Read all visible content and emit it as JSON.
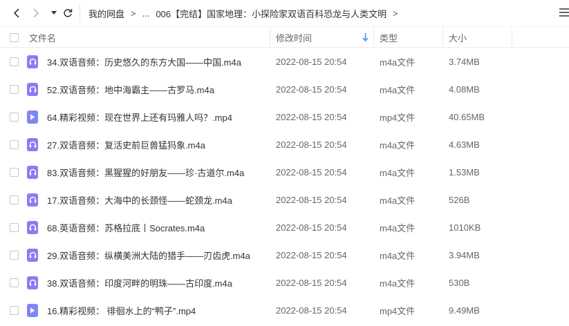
{
  "nav": {
    "breadcrumb": [
      {
        "label": "我的网盘"
      },
      {
        "label": "..."
      },
      {
        "label": "006【完结】国家地理：小探险家双语百科恐龙与人类文明"
      }
    ],
    "separator": ">"
  },
  "header": {
    "name": "文件名",
    "time": "修改时间",
    "type": "类型",
    "size": "大小"
  },
  "colors": {
    "audio_icon": "#8a7cf2",
    "video_icon": "#7f86f5",
    "sort_arrow": "#3b8cff"
  },
  "files": [
    {
      "name": "34.双语音频：历史悠久的东方大国——中国.m4a",
      "time": "2022-08-15 20:54",
      "type": "m4a文件",
      "size": "3.74MB",
      "icon": "audio-icon"
    },
    {
      "name": "52.双语音频：地中海霸主——古罗马.m4a",
      "time": "2022-08-15 20:54",
      "type": "m4a文件",
      "size": "4.08MB",
      "icon": "audio-icon"
    },
    {
      "name": "64.精彩视频：现在世界上还有玛雅人吗？.mp4",
      "time": "2022-08-15 20:54",
      "type": "mp4文件",
      "size": "40.65MB",
      "icon": "video-icon"
    },
    {
      "name": "27.双语音频：复活史前巨兽猛犸象.m4a",
      "time": "2022-08-15 20:54",
      "type": "m4a文件",
      "size": "4.63MB",
      "icon": "audio-icon"
    },
    {
      "name": "83.双语音频：黑猩猩的好朋友——珍·古道尔.m4a",
      "time": "2022-08-15 20:54",
      "type": "m4a文件",
      "size": "1.53MB",
      "icon": "audio-icon"
    },
    {
      "name": "17.双语音频：大海中的长颈怪——蛇颈龙.m4a",
      "time": "2022-08-15 20:54",
      "type": "m4a文件",
      "size": "526B",
      "icon": "audio-icon"
    },
    {
      "name": "68.英语音频：苏格拉底丨Socrates.m4a",
      "time": "2022-08-15 20:54",
      "type": "m4a文件",
      "size": "1010KB",
      "icon": "audio-icon"
    },
    {
      "name": "29.双语音频：纵横美洲大陆的猎手——刃齿虎.m4a",
      "time": "2022-08-15 20:54",
      "type": "m4a文件",
      "size": "3.94MB",
      "icon": "audio-icon"
    },
    {
      "name": "38.双语音频：印度河畔的明珠——古印度.m4a",
      "time": "2022-08-15 20:54",
      "type": "m4a文件",
      "size": "530B",
      "icon": "audio-icon"
    },
    {
      "name": "16.精彩视频： 徘徊水上的“鸭子”.mp4",
      "time": "2022-08-15 20:54",
      "type": "mp4文件",
      "size": "9.49MB",
      "icon": "video-icon"
    }
  ]
}
